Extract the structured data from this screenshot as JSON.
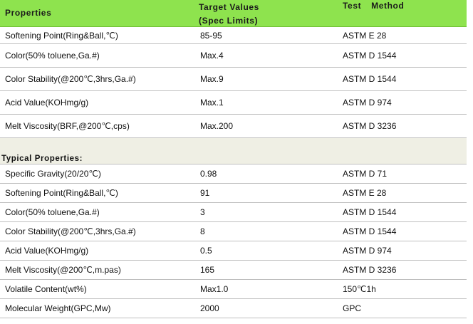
{
  "header": {
    "col1": "Properties",
    "col2_line1": "Target Values",
    "col2_line2": "(Spec Limits)",
    "col3": "Test Method"
  },
  "spec_rows": [
    {
      "property": "Softening Point(Ring&Ball,℃)",
      "value": "85-95",
      "method": "ASTM E 28"
    },
    {
      "property": "Color(50% toluene,Ga.#)",
      "value": "Max.4",
      "method": "ASTM D 1544"
    },
    {
      "property": "Color Stability(@200℃,3hrs,Ga.#)",
      "value": "Max.9",
      "method": "ASTM D 1544"
    },
    {
      "property": "Acid Value(KOHmg/g)",
      "value": "Max.1",
      "method": "ASTM D 974"
    },
    {
      "property": "Melt Viscosity(BRF,@200℃,cps)",
      "value": "Max.200",
      "method": "ASTM D 3236"
    }
  ],
  "section_title": "Typical Properties:",
  "typical_rows": [
    {
      "property": "Specific Gravity(20/20℃)",
      "value": "0.98",
      "method": "ASTM D 71"
    },
    {
      "property": "Softening Point(Ring&Ball,℃)",
      "value": "91",
      "method": "ASTM E 28"
    },
    {
      "property": "Color(50% toluene,Ga.#)",
      "value": "3",
      "method": "ASTM D 1544"
    },
    {
      "property": "Color Stability(@200℃,3hrs,Ga.#)",
      "value": "8",
      "method": "ASTM D 1544"
    },
    {
      "property": "Acid Value(KOHmg/g)",
      "value": "0.5",
      "method": "ASTM D 974"
    },
    {
      "property": "Melt Viscosity(@200℃,m.pas)",
      "value": "165",
      "method": "ASTM D 3236"
    },
    {
      "property": "Volatile Content(wt%)",
      "value": "Max1.0",
      "method": "150℃1h"
    },
    {
      "property": "Molecular Weight(GPC,Mw)",
      "value": "2000",
      "method": "GPC"
    }
  ]
}
